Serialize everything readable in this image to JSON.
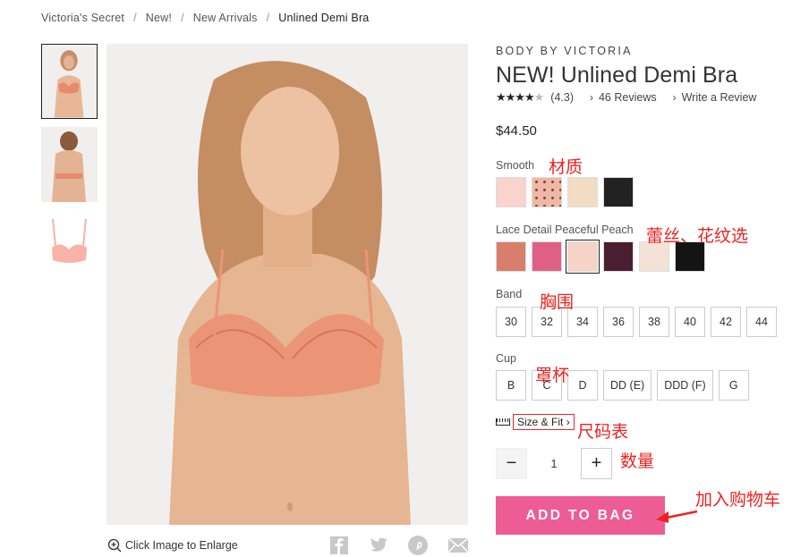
{
  "breadcrumb": [
    "Victoria's Secret",
    "New!",
    "New Arrivals",
    "Unlined Demi Bra"
  ],
  "breadcrumb_sep": "/",
  "product": {
    "brand": "BODY BY VICTORIA",
    "title": "NEW! Unlined Demi Bra",
    "rating_text": "(4.3)",
    "rating_value": 4.3,
    "reviews_link": "46 Reviews",
    "write_review": "Write a Review",
    "price": "$44.50"
  },
  "options": {
    "smooth_label": "Smooth",
    "smooth_colors": [
      "#f9d3cc",
      "#f0b8a4",
      "#f2dcc4",
      "#222222"
    ],
    "lace_label": "Lace Detail Peaceful Peach",
    "lace_colors": [
      "#d87e6b",
      "#e06083",
      "#f6d3c6",
      "#4b1d30",
      "#f4e2d6",
      "#141414"
    ],
    "band_label": "Band",
    "bands": [
      "30",
      "32",
      "34",
      "36",
      "38",
      "40",
      "42",
      "44"
    ],
    "cup_label": "Cup",
    "cups": [
      "B",
      "C",
      "D",
      "DD (E)",
      "DDD (F)",
      "G"
    ]
  },
  "size_fit": "Size & Fit",
  "quantity": {
    "minus": "−",
    "value": "1",
    "plus": "+"
  },
  "add_to_bag": "ADD TO BAG",
  "enlarge_text": "Click Image to Enlarge",
  "share_icons": [
    "facebook-icon",
    "twitter-icon",
    "pinterest-icon",
    "email-icon"
  ],
  "annotations": {
    "material": "材质",
    "lace_pattern": "蕾丝、花纹选",
    "band": "胸围",
    "cup": "罩杯",
    "size_chart": "尺码表",
    "quantity": "数量",
    "add_cart": "加入购物车"
  },
  "colors": {
    "accent_pink": "#ee5c95",
    "annotation_red": "#e22222"
  }
}
